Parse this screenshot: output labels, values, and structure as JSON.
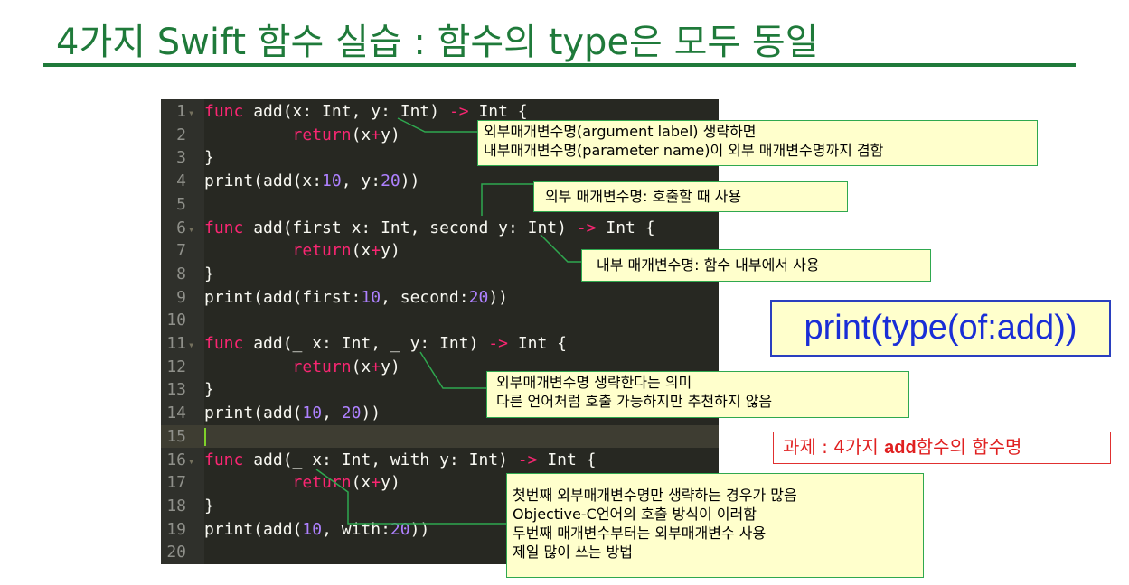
{
  "title": "4가지 Swift 함수 실습 : 함수의 type은 모두 동일",
  "code_lines": [
    {
      "n": "1",
      "fold": true,
      "html": [
        [
          "kw",
          "func"
        ],
        [
          "code",
          " add(x: Int, y: Int) "
        ],
        [
          "op",
          "->"
        ],
        [
          "code",
          " Int {"
        ]
      ]
    },
    {
      "n": "2",
      "fold": false,
      "html": [
        [
          "code",
          "         "
        ],
        [
          "kw",
          "return"
        ],
        [
          "code",
          "(x"
        ],
        [
          "op",
          "+"
        ],
        [
          "code",
          "y)"
        ]
      ]
    },
    {
      "n": "3",
      "fold": false,
      "html": [
        [
          "code",
          "}"
        ]
      ]
    },
    {
      "n": "4",
      "fold": false,
      "html": [
        [
          "code",
          "print(add(x:"
        ],
        [
          "num",
          "10"
        ],
        [
          "code",
          ", y:"
        ],
        [
          "num",
          "20"
        ],
        [
          "code",
          "))"
        ]
      ]
    },
    {
      "n": "5",
      "fold": false,
      "html": []
    },
    {
      "n": "6",
      "fold": true,
      "html": [
        [
          "kw",
          "func"
        ],
        [
          "code",
          " add(first x: Int, second y: Int) "
        ],
        [
          "op",
          "->"
        ],
        [
          "code",
          " Int {"
        ]
      ]
    },
    {
      "n": "7",
      "fold": false,
      "html": [
        [
          "code",
          "         "
        ],
        [
          "kw",
          "return"
        ],
        [
          "code",
          "(x"
        ],
        [
          "op",
          "+"
        ],
        [
          "code",
          "y)"
        ]
      ]
    },
    {
      "n": "8",
      "fold": false,
      "html": [
        [
          "code",
          "}"
        ]
      ]
    },
    {
      "n": "9",
      "fold": false,
      "html": [
        [
          "code",
          "print(add(first:"
        ],
        [
          "num",
          "10"
        ],
        [
          "code",
          ", second:"
        ],
        [
          "num",
          "20"
        ],
        [
          "code",
          "))"
        ]
      ]
    },
    {
      "n": "10",
      "fold": false,
      "html": []
    },
    {
      "n": "11",
      "fold": true,
      "html": [
        [
          "kw",
          "func"
        ],
        [
          "code",
          " add(_ x: Int, _ y: Int) "
        ],
        [
          "op",
          "->"
        ],
        [
          "code",
          " Int {"
        ]
      ]
    },
    {
      "n": "12",
      "fold": false,
      "html": [
        [
          "code",
          "         "
        ],
        [
          "kw",
          "return"
        ],
        [
          "code",
          "(x"
        ],
        [
          "op",
          "+"
        ],
        [
          "code",
          "y)"
        ]
      ]
    },
    {
      "n": "13",
      "fold": false,
      "html": [
        [
          "code",
          "}"
        ]
      ]
    },
    {
      "n": "14",
      "fold": false,
      "html": [
        [
          "code",
          "print(add("
        ],
        [
          "num",
          "10"
        ],
        [
          "code",
          ", "
        ],
        [
          "num",
          "20"
        ],
        [
          "code",
          "))"
        ]
      ]
    },
    {
      "n": "15",
      "fold": false,
      "html": [],
      "cursor": true
    },
    {
      "n": "16",
      "fold": true,
      "html": [
        [
          "kw",
          "func"
        ],
        [
          "code",
          " add(_ x: Int, with y: Int) "
        ],
        [
          "op",
          "->"
        ],
        [
          "code",
          " Int {"
        ]
      ]
    },
    {
      "n": "17",
      "fold": false,
      "html": [
        [
          "code",
          "         "
        ],
        [
          "kw",
          "return"
        ],
        [
          "code",
          "(x"
        ],
        [
          "op",
          "+"
        ],
        [
          "code",
          "y)"
        ]
      ]
    },
    {
      "n": "18",
      "fold": false,
      "html": [
        [
          "code",
          "}"
        ]
      ]
    },
    {
      "n": "19",
      "fold": false,
      "html": [
        [
          "code",
          "print(add("
        ],
        [
          "num",
          "10"
        ],
        [
          "code",
          ", with:"
        ],
        [
          "num",
          "20"
        ],
        [
          "code",
          "))"
        ]
      ]
    },
    {
      "n": "20",
      "fold": false,
      "html": []
    }
  ],
  "notes": {
    "n1_line1": "외부매개변수명(argument label) 생략하면",
    "n1_line2": "내부매개변수명(parameter name)이 외부 매개변수명까지 겸함",
    "n2": "외부 매개변수명: 호출할 때 사용",
    "n3": "내부 매개변수명: 함수 내부에서 사용",
    "n4_line1": "외부매개변수명 생략한다는 의미",
    "n4_line2": "다른 언어처럼 호출 가능하지만 추천하지 않음",
    "n5_line1": "첫번째 외부매개변수명만 생략하는 경우가 많음",
    "n5_line2": "Objective-C언어의 호출 방식이 이러함",
    "n5_line3": "두번째 매개변수부터는 외부매개변수 사용",
    "n5_line4": "제일 많이 쓰는 방법"
  },
  "big_box": "print(type(of:add))",
  "homework": {
    "prefix": "과제 : 4가지 ",
    "bold": "add",
    "suffix": "함수의 함수명"
  },
  "colors": {
    "title": "#1f7a3a",
    "editor_bg": "#272822",
    "keyword": "#f92672",
    "number": "#ae81ff",
    "note_bg": "#ffffcc",
    "note_border": "#2fa84f",
    "big_text": "#1a2ed6",
    "homework": "#e02020"
  }
}
